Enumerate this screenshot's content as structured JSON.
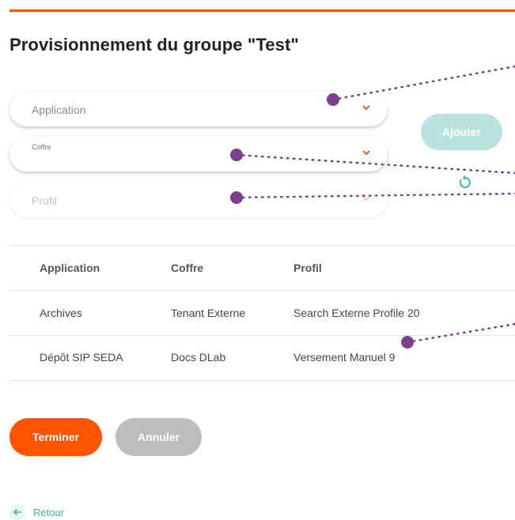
{
  "page": {
    "title": "Provisionnement du groupe \"Test\""
  },
  "form": {
    "application": {
      "placeholder": "Application"
    },
    "coffre": {
      "label": "Coffre",
      "value": ""
    },
    "profil": {
      "placeholder": "Profil"
    },
    "add_button": "Ajouter"
  },
  "table": {
    "columns": [
      "Application",
      "Coffre",
      "Profil"
    ],
    "rows": [
      [
        "Archives",
        "Tenant Externe",
        "Search Externe Profile 20"
      ],
      [
        "Dépôt SIP SEDA",
        "Docs DLab",
        "Versement Manuel 9"
      ]
    ]
  },
  "actions": {
    "finish": "Terminer",
    "cancel": "Annuler"
  },
  "nav": {
    "back": "Retour"
  },
  "colors": {
    "accent": "#fe5400",
    "teal": "#41b6a2",
    "teal_disabled": "#b8e4dd",
    "grey_button": "#bdbdbd",
    "annotation": "#7b3f8c"
  },
  "icons": {
    "dropdown": "chevron-down-icon",
    "reset": "reset-icon",
    "back": "arrow-left-icon"
  }
}
